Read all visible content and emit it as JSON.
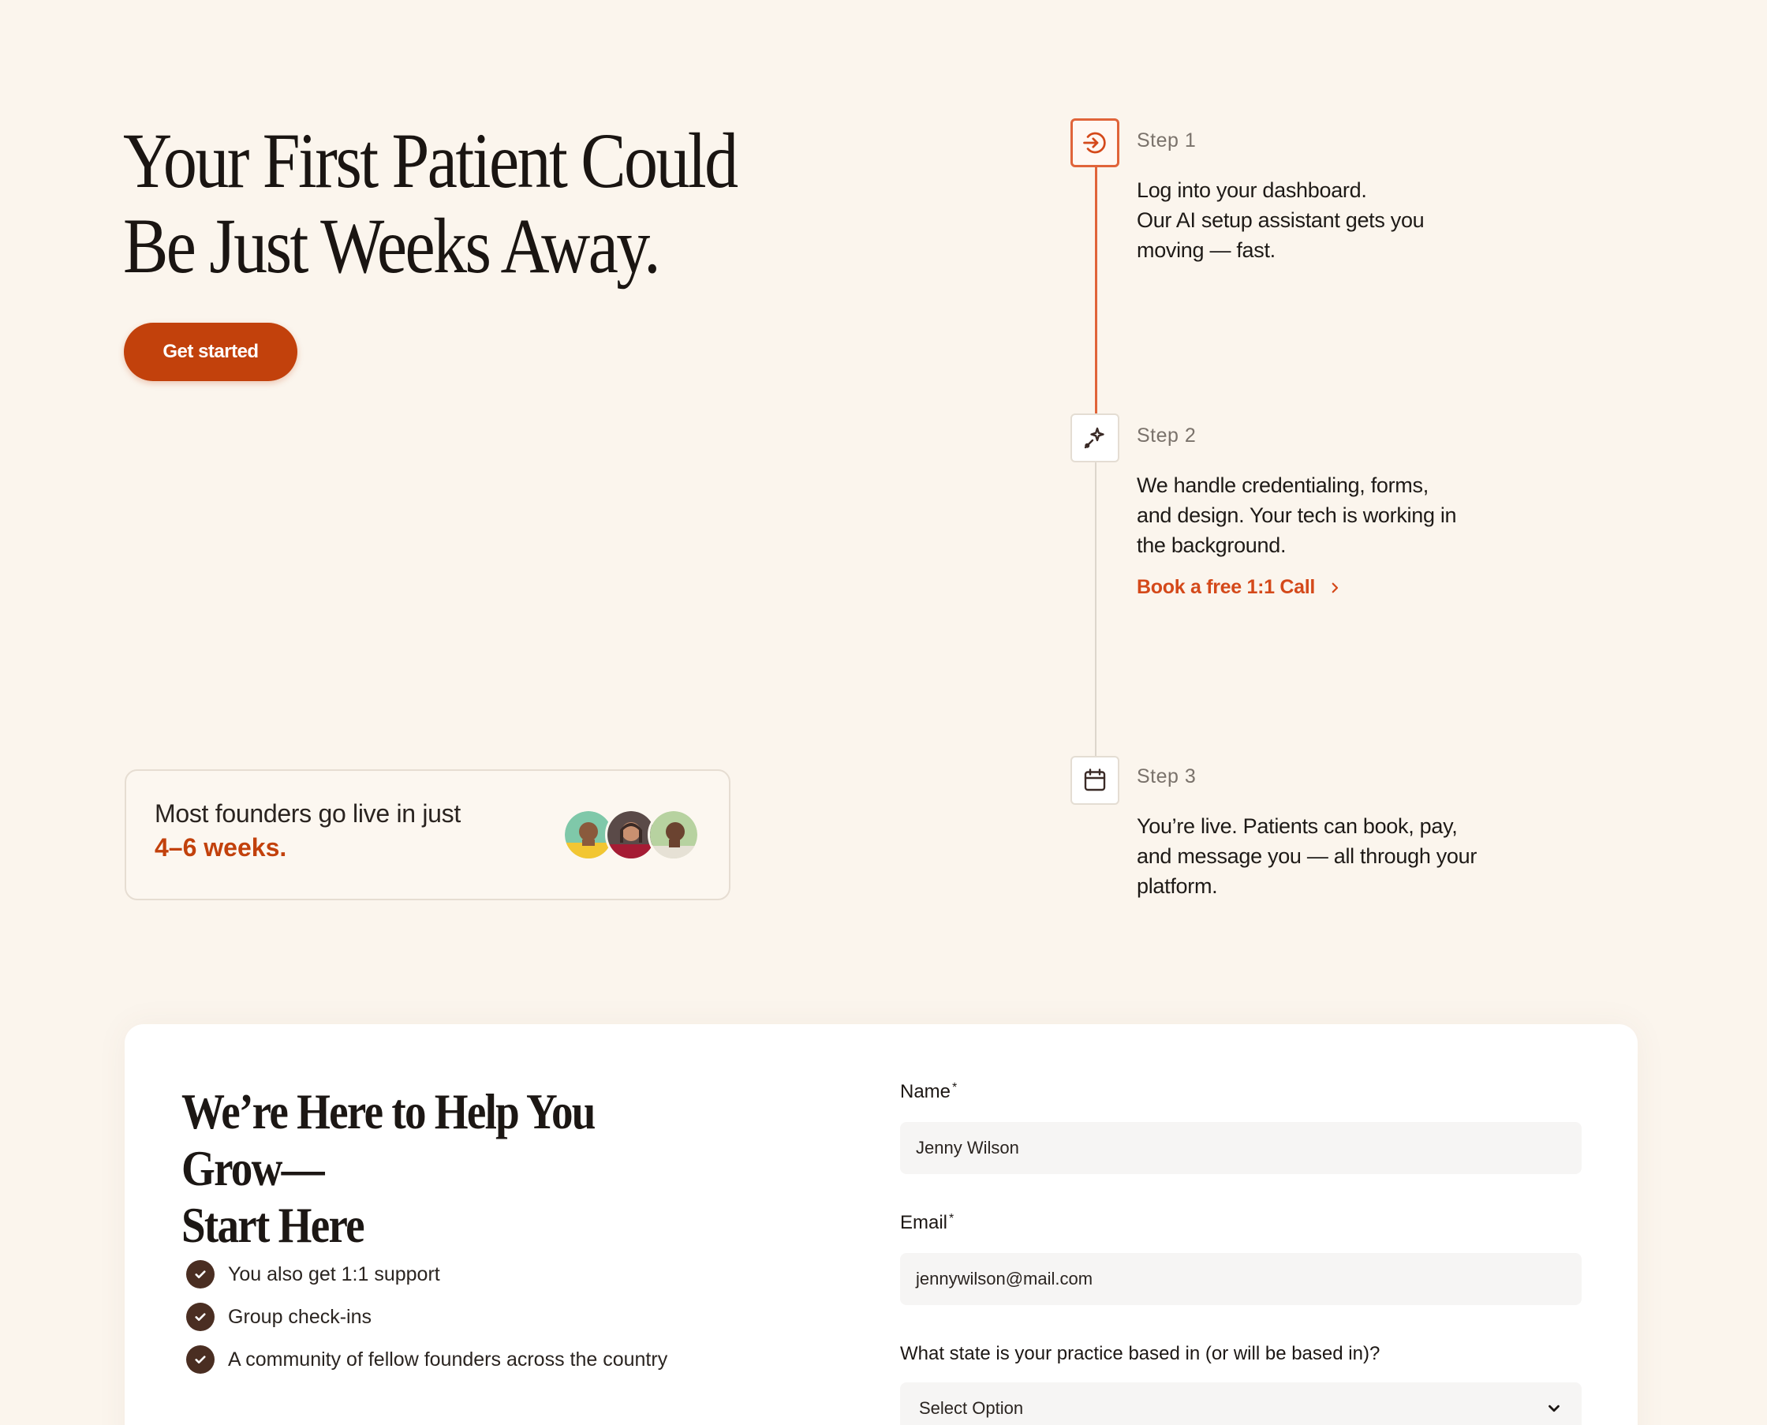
{
  "hero": {
    "title_line1": "Your First Patient Could",
    "title_line2": "Be Just Weeks Away.",
    "cta_label": "Get started"
  },
  "founders": {
    "line1": "Most founders go live in just",
    "line2": "4–6 weeks.",
    "avatars": [
      "avatar-1",
      "avatar-2",
      "avatar-3"
    ]
  },
  "steps": [
    {
      "label": "Step 1",
      "icon": "login-arrow-icon",
      "lines": [
        "Log into your dashboard.",
        "Our AI setup assistant gets you",
        "moving — fast."
      ]
    },
    {
      "label": "Step 2",
      "icon": "sparkle-wand-icon",
      "lines": [
        "We handle credentialing, forms,",
        "and design. Your tech is working in",
        "the background."
      ],
      "link": "Book a free 1:1 Call"
    },
    {
      "label": "Step 3",
      "icon": "calendar-icon",
      "lines": [
        "You’re live. Patients can book, pay,",
        "and message you — all through your",
        "platform."
      ]
    }
  ],
  "form_section": {
    "title_line1": "We’re Here to Help You Grow—",
    "title_line2": "Start Here",
    "checklist": [
      "You also get 1:1 support",
      "Group check-ins",
      "A community of fellow founders across the country"
    ],
    "name_label": "Name",
    "name_value": "Jenny Wilson",
    "email_label": "Email",
    "email_value": "jennywilson@mail.com",
    "state_label": "What state is your practice based in (or will be based in)?",
    "state_value": "Select Option",
    "required_mark": "*"
  },
  "colors": {
    "background": "#fbf5ed",
    "accent": "#c2410c",
    "accent_light": "#e0643a",
    "check": "#4a2e22"
  }
}
